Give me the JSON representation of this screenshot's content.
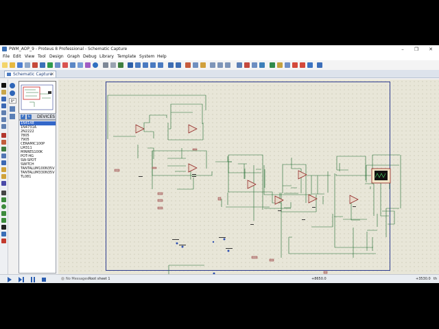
{
  "window": {
    "title": "PWM_AOP_9 - Proteus 8 Professional - Schematic Capture"
  },
  "menu": [
    "File",
    "Edit",
    "View",
    "Tool",
    "Design",
    "Graph",
    "Debug",
    "Library",
    "Template",
    "System",
    "Help"
  ],
  "tab": {
    "label": "Schematic Capture"
  },
  "sidebar": {
    "angle": "0°",
    "devices_title": "DEVICES",
    "pick_label": "P",
    "lib_label": "L"
  },
  "devices": [
    "1N4148",
    "1N4731A",
    "2N2222",
    "7805",
    "7905",
    "CERAMIC100P",
    "LM311",
    "MINRES100K",
    "POT-HG",
    "SW-SPDT",
    "SWITCH",
    "TANTALUM100N35V",
    "TANTALUM330N35V",
    "TL081"
  ],
  "selected_device": "1N4148",
  "status": {
    "message": "No Messages",
    "sheet": "Root sheet 1",
    "x": "+8650.0",
    "y": "+3530.0",
    "unit": "th"
  }
}
